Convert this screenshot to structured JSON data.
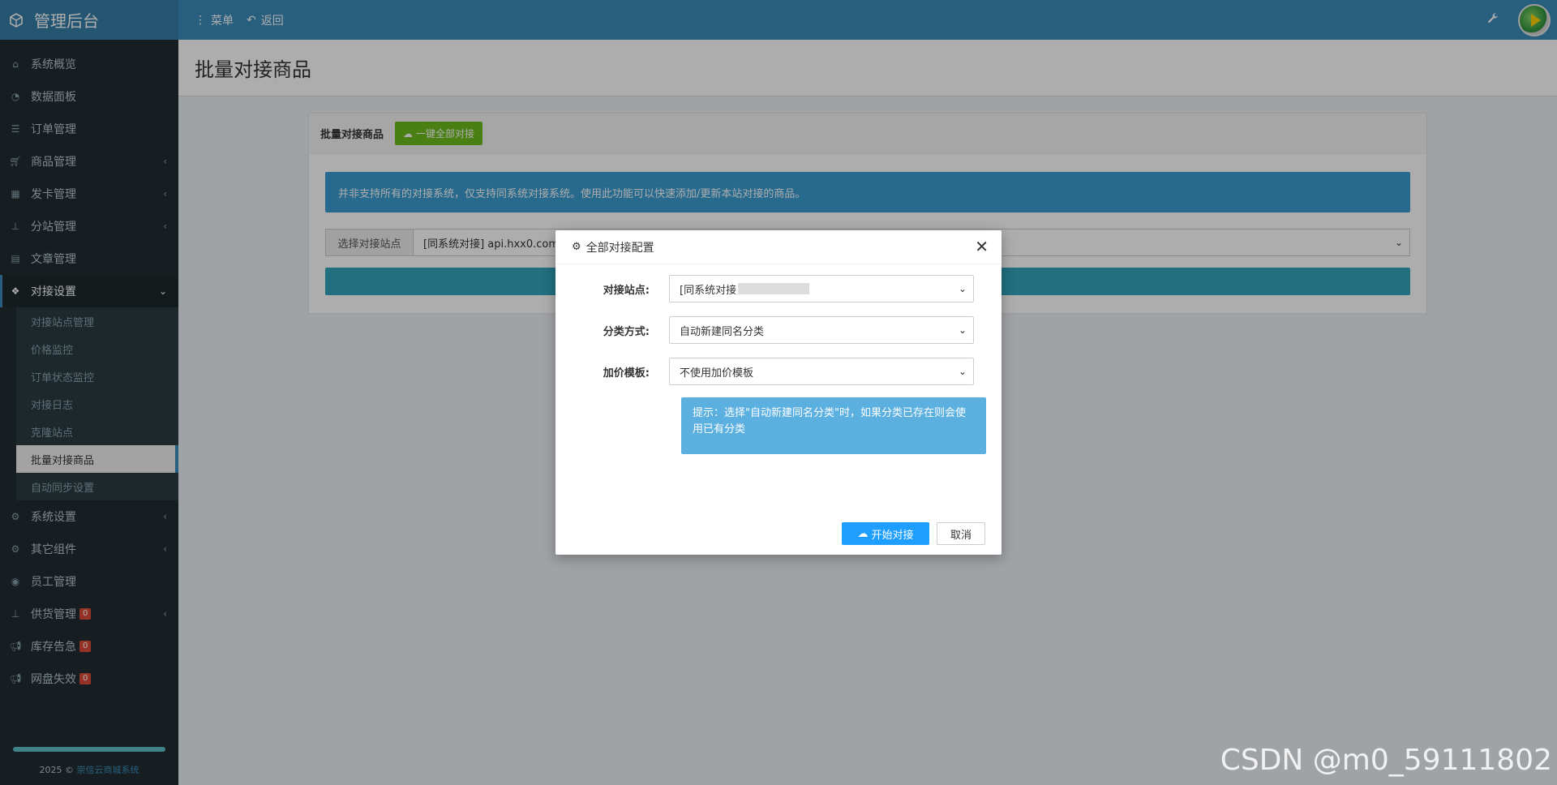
{
  "header": {
    "brand": "管理后台",
    "menu_label": "菜单",
    "back_label": "返回"
  },
  "sidebar": {
    "items": [
      {
        "label": "系统概览",
        "icon": "home-icon"
      },
      {
        "label": "数据面板",
        "icon": "dashboard-icon"
      },
      {
        "label": "订单管理",
        "icon": "list-icon"
      },
      {
        "label": "商品管理",
        "icon": "cart-icon"
      },
      {
        "label": "发卡管理",
        "icon": "grid-icon"
      },
      {
        "label": "分站管理",
        "icon": "sitemap-icon"
      },
      {
        "label": "文章管理",
        "icon": "book-icon"
      },
      {
        "label": "对接设置",
        "icon": "cubes-icon"
      }
    ],
    "submenu": [
      "对接站点管理",
      "价格监控",
      "订单状态监控",
      "对接日志",
      "克隆站点",
      "批量对接商品",
      "自动同步设置"
    ],
    "items_after": [
      {
        "label": "系统设置",
        "icon": "gear-icon",
        "badge": ""
      },
      {
        "label": "其它组件",
        "icon": "cogs-icon",
        "badge": ""
      },
      {
        "label": "员工管理",
        "icon": "user-icon",
        "badge": ""
      },
      {
        "label": "供货管理",
        "icon": "sitemap-icon",
        "badge": "0"
      },
      {
        "label": "库存告急",
        "icon": "bullhorn-icon",
        "badge": "0"
      },
      {
        "label": "网盘失效",
        "icon": "bullhorn-icon",
        "badge": "0"
      }
    ],
    "footer_year": "2025 ©",
    "footer_link": "崇信云商城系统"
  },
  "page": {
    "title": "批量对接商品",
    "panel_title": "批量对接商品",
    "one_click_label": "一键全部对接",
    "alert": "并非支持所有的对接系统，仅支持同系统对接系统。使用此功能可以快速添加/更新本站对接的商品。",
    "select_site_label": "选择对接站点",
    "select_site_value": "[同系统对接] api.hxx0.com"
  },
  "modal": {
    "title": "全部对接配置",
    "site_label": "对接站点:",
    "site_value": "[同系统对接",
    "category_label": "分类方式:",
    "category_value": "自动新建同名分类",
    "price_label": "加价模板:",
    "price_value": "不使用加价模板",
    "hint": "提示：选择\"自动新建同名分类\"时，如果分类已存在则会使用已有分类",
    "start_label": "开始对接",
    "cancel_label": "取消"
  },
  "watermark": "CSDN @m0_59111802"
}
